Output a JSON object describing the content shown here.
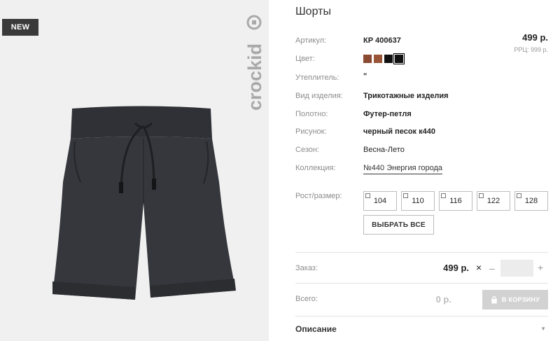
{
  "badge": {
    "label": "NEW"
  },
  "brand": {
    "logo_text": "crockid"
  },
  "product": {
    "title": "Шорты",
    "price": "499 р.",
    "rrp": "РРЦ: 999 р."
  },
  "attributes": {
    "article": {
      "label": "Артикул:",
      "value": "КР 400637"
    },
    "color": {
      "label": "Цвет:"
    },
    "insulation": {
      "label": "Утеплитель:",
      "value": "\""
    },
    "type": {
      "label": "Вид изделия:",
      "value": "Трикотажные изделия"
    },
    "fabric": {
      "label": "Полотно:",
      "value": "Футер-петля"
    },
    "pattern": {
      "label": "Рисунок:",
      "value": "черный песок к440"
    },
    "season": {
      "label": "Сезон:",
      "value": "Весна-Лето"
    },
    "collection": {
      "label": "Коллекция:",
      "value": "№440 Энергия города"
    }
  },
  "swatches": [
    {
      "color": "#8b4a32",
      "selected": false
    },
    {
      "color": "#9a5537",
      "selected": false
    },
    {
      "color": "#111111",
      "selected": false
    },
    {
      "color": "#111111",
      "selected": true
    }
  ],
  "sizes": {
    "label": "Рост/размер:",
    "options": [
      "104",
      "110",
      "116",
      "122",
      "128"
    ],
    "select_all": "ВЫБРАТЬ ВСЕ"
  },
  "order": {
    "label": "Заказ:",
    "price": "499 р.",
    "times": "×",
    "minus": "–",
    "plus": "+",
    "quantity": ""
  },
  "total": {
    "label": "Всего:",
    "value": "0 р.",
    "cart_button": "В КОРЗИНУ"
  },
  "description": {
    "label": "Описание"
  }
}
